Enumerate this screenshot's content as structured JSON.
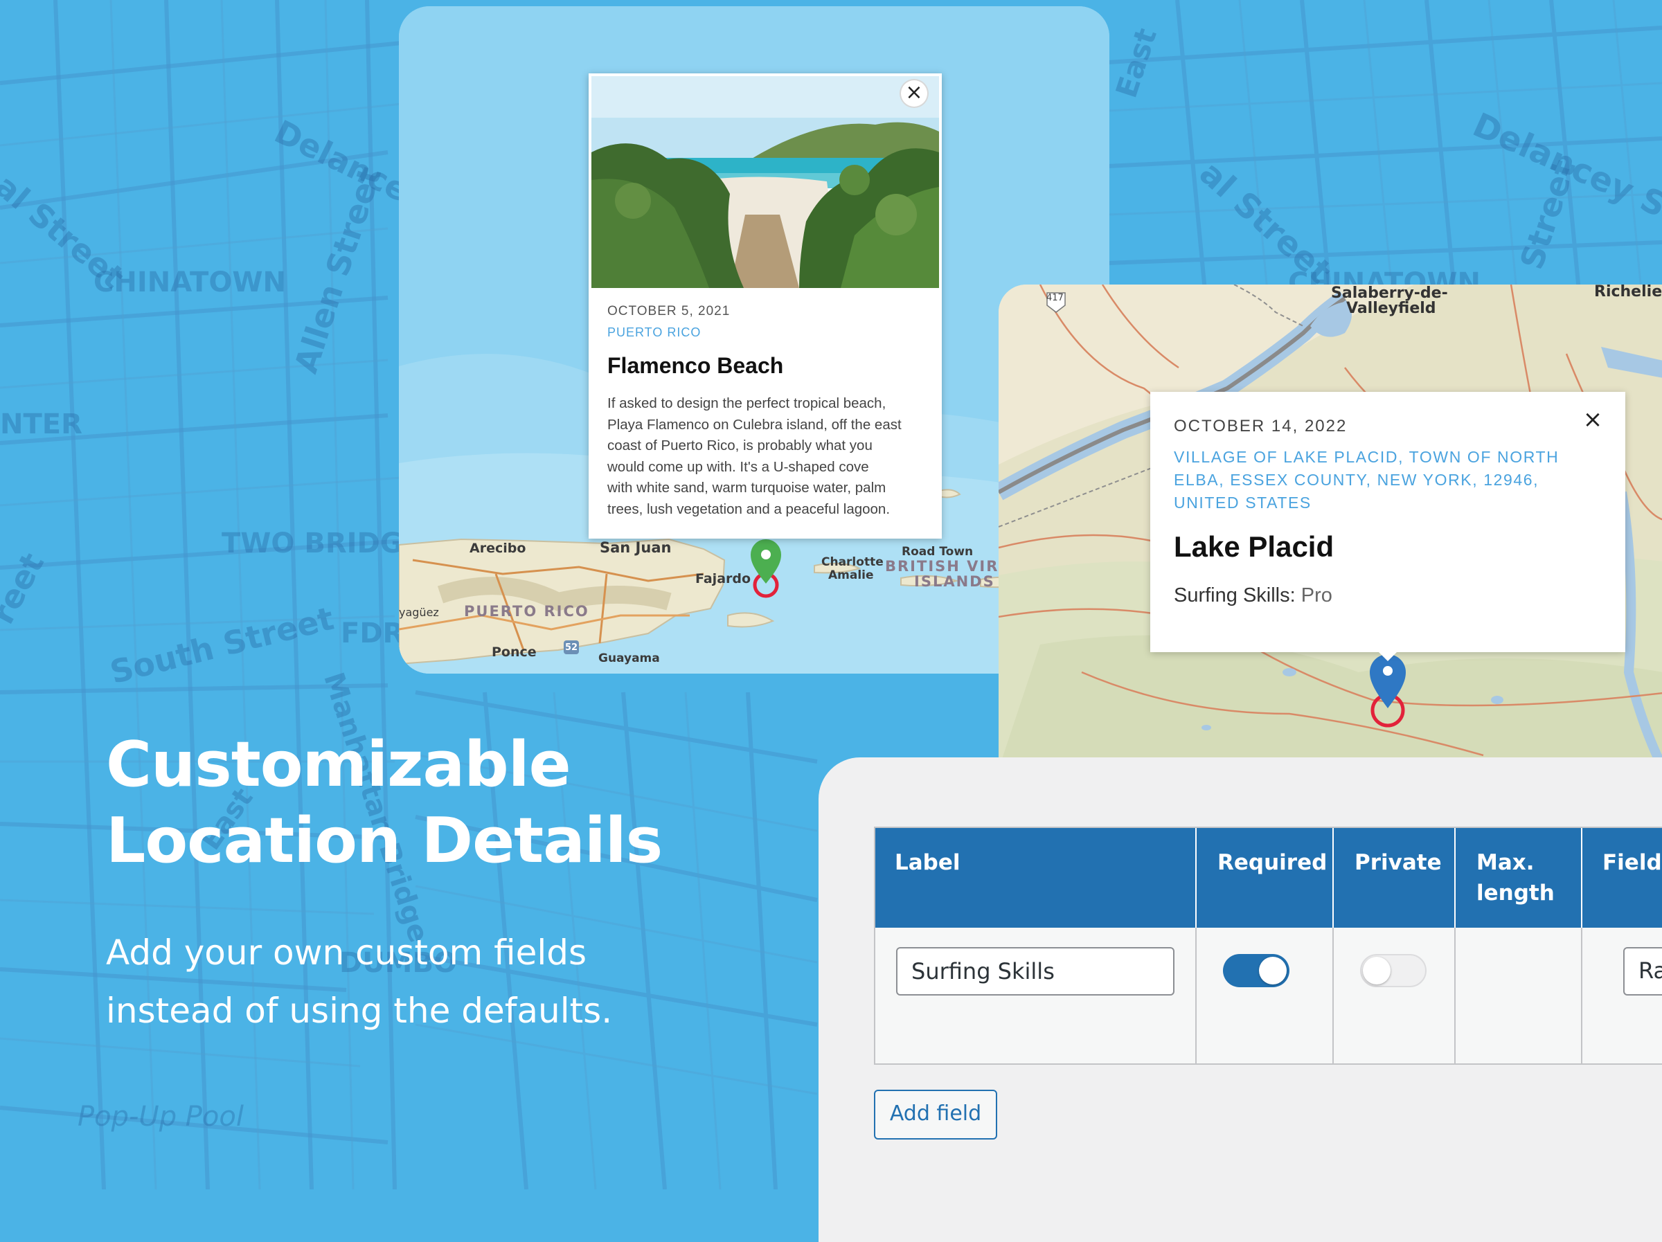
{
  "colors": {
    "background": "#4bb3e6",
    "accent_blue": "#2271b1",
    "popup_location": "#4aa3df",
    "pin_green": "#4caf50",
    "pin_blue": "#2f78c4",
    "ring_red": "#e2223a"
  },
  "background_map": {
    "labels": [
      "Delancey Street",
      "al Street",
      "Allen Street",
      "CHINATOWN",
      "NTER",
      "TWO BRIDGE",
      "South Street",
      "FDR",
      "Manhattan Bridge",
      "East",
      "DUMBO",
      "Pop-Up Pool",
      "reet",
      "Delancey Str",
      "al Street",
      "Street",
      "CHINATOWN",
      "East"
    ]
  },
  "hero": {
    "title_line1": "Customizable",
    "title_line2": "Location Details",
    "subtitle_line1": "Add your own custom fields",
    "subtitle_line2": "instead of using the defaults."
  },
  "puerto_rico_map": {
    "labels": {
      "arecibo": "Arecibo",
      "san_juan": "San Juan",
      "fajardo": "Fajardo",
      "charlotte_amalie_1": "Charlotte",
      "charlotte_amalie_2": "Amalie",
      "road_town": "Road Town",
      "bvi_1": "BRITISH VIRG",
      "bvi_2": "ISLANDS",
      "mayaguez": "yagüez",
      "puerto_rico": "PUERTO RICO",
      "ponce": "Ponce",
      "guayama": "Guayama",
      "route": "52"
    },
    "popup": {
      "close_icon": "×",
      "date": "OCTOBER 5, 2021",
      "location": "PUERTO RICO",
      "title": "Flamenco Beach",
      "body_lines": [
        "If asked to design the perfect tropical beach,",
        "Playa Flamenco on Culebra island, off the east",
        "coast of Puerto Rico, is probably what you",
        "would come up with. It's a U-shaped cove",
        "with white sand, warm turquoise water, palm",
        "trees, lush vegetation and a peaceful lagoon."
      ]
    }
  },
  "lake_placid_map": {
    "labels": {
      "route": "417",
      "salaberry_1": "Salaberry-de-",
      "salaberry_2": "Valleyfield",
      "richelieu": "Richelie"
    },
    "popup": {
      "close_icon": "×",
      "date": "OCTOBER 14, 2022",
      "location_lines": [
        "VILLAGE OF LAKE PLACID, TOWN OF NORTH",
        "ELBA, ESSEX COUNTY, NEW YORK, 12946,",
        "UNITED STATES"
      ],
      "title": "Lake Placid",
      "field_label": "Surfing Skills:",
      "field_value": "Pro"
    }
  },
  "custom_fields": {
    "columns": [
      "Label",
      "Required",
      "Private",
      "Max.",
      "length",
      "Field"
    ],
    "row": {
      "label_value": "Surfing Skills",
      "required": true,
      "private": false,
      "field_type_partial": "Rad"
    },
    "add_button": "Add field"
  }
}
